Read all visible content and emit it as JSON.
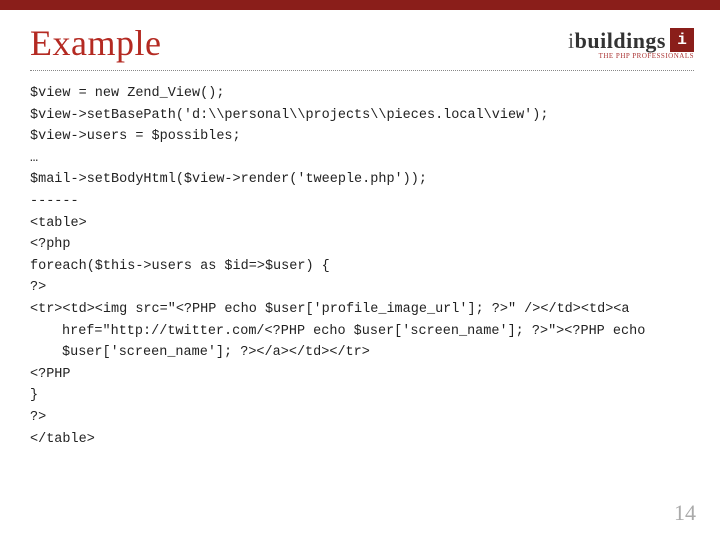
{
  "header": {
    "title": "Example",
    "logo_text_prefix": "i",
    "logo_text_main": "buildings",
    "logo_badge": "i",
    "logo_subtitle": "THE PHP PROFESSIONALS"
  },
  "code": {
    "l01": "$view = new Zend_View();",
    "l02": "$view->setBasePath('d:\\\\personal\\\\projects\\\\pieces.local\\view');",
    "l03": "$view->users = $possibles;",
    "l04": "…",
    "l05": "$mail->setBodyHtml($view->render('tweeple.php'));",
    "l06": "------",
    "l07": "<table>",
    "l08": "<?php",
    "l09": "foreach($this->users as $id=>$user) {",
    "l10": "?>",
    "l11a": "<tr><td><img src=\"<?PHP echo $user['profile_image_url']; ?>\" /></td><td><a",
    "l11b": "href=\"http://twitter.com/<?PHP echo $user['screen_name']; ?>\"><?PHP echo",
    "l11c": "$user['screen_name']; ?></a></td></tr>",
    "l12": "<?PHP",
    "l13": "}",
    "l14": "?>",
    "l15": "</table>"
  },
  "page_number": "14"
}
